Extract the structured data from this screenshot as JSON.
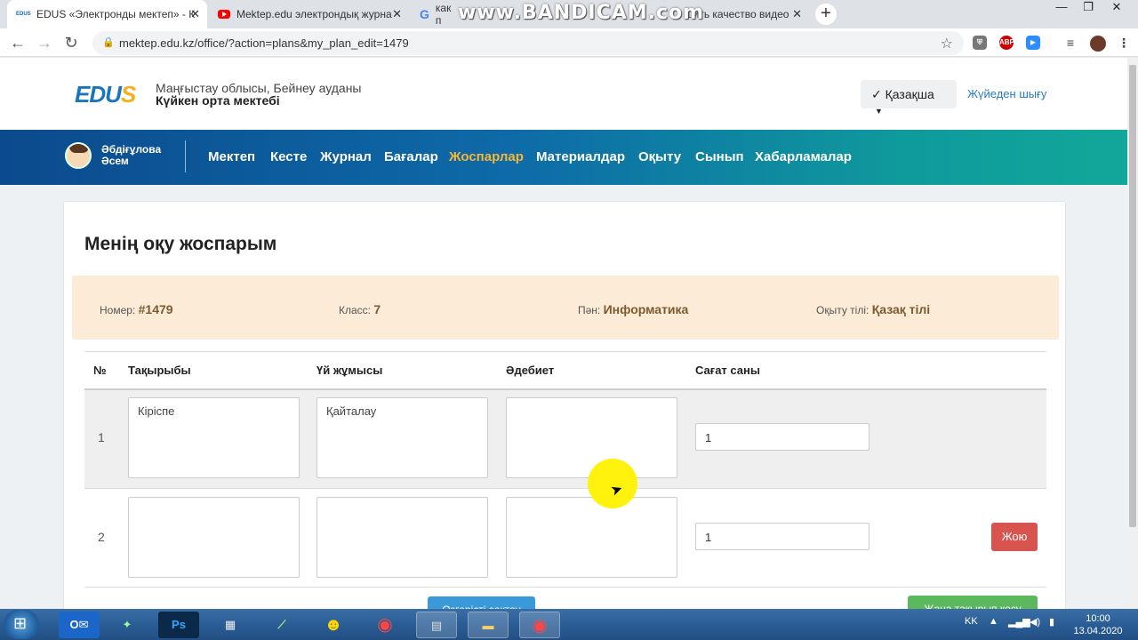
{
  "browser": {
    "tabs": [
      {
        "label": "EDUS «Электронды мектеп» - К",
        "favicon": "edus-icon"
      },
      {
        "label": "Mektep.edu электрондық журна",
        "favicon": "youtube-icon"
      },
      {
        "label": "как п",
        "favicon": "google-icon"
      },
      {
        "label": "шить качество видео Y",
        "favicon": "youtube-icon"
      }
    ],
    "watermark": "www.BANDICAM.com",
    "url": "mektep.edu.kz/office/?action=plans&my_plan_edit=1479",
    "extensions": [
      "shield-icon",
      "abp-icon",
      "zoom-icon",
      "playlist-icon",
      "profile-avatar"
    ]
  },
  "header": {
    "logo": "EDUS",
    "region": "Маңғыстау облысы, Бейнеу ауданы",
    "school": "Күйкен орта мектебі",
    "language": "✓ Қазақша",
    "logout": "Жүйеден шығу"
  },
  "menu": {
    "user_name": "Әбдіғұлова Әсем",
    "items": [
      "Мектеп",
      "Кесте",
      "Журнал",
      "Бағалар",
      "Жоспарлар",
      "Материалдар",
      "Оқыту",
      "Сынып",
      "Хабарламалар"
    ],
    "active": "Жоспарлар"
  },
  "plan": {
    "title": "Менің оқу жоспарым",
    "number_label": "Номер:",
    "number": "#1479",
    "class_label": "Класс:",
    "class": "7",
    "subject_label": "Пән:",
    "subject": "Информатика",
    "lang_label": "Оқыту тілі:",
    "lang": "Қазақ тілі"
  },
  "table": {
    "headers": [
      "№",
      "Тақырыбы",
      "Үй жұмысы",
      "Әдебиет",
      "Сағат саны"
    ],
    "rows": [
      {
        "num": "1",
        "topic": "Кіріспе",
        "homework": "Қайталау",
        "literature": "",
        "hours": "1"
      },
      {
        "num": "2",
        "topic": "",
        "homework": "",
        "literature": "",
        "hours": "1",
        "delete": "Жою"
      }
    ]
  },
  "footer_buttons": {
    "save": "Өзгерісті сақтау",
    "add": "Жаңа тақырып қосу"
  },
  "taskbar": {
    "lang": "KK",
    "time": "10:00",
    "date": "13.04.2020"
  }
}
